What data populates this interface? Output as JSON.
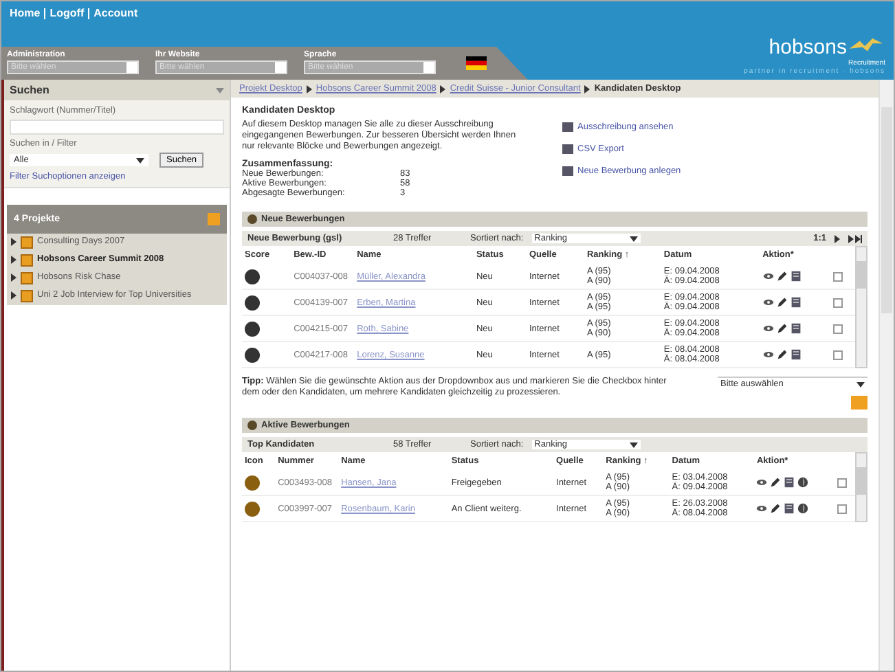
{
  "header": {
    "links": [
      "Home",
      "Logoff",
      "Account"
    ],
    "selectors": [
      {
        "label": "Administration",
        "placeholder": "Bitte wählen"
      },
      {
        "label": "Ihr Website",
        "placeholder": "Bitte wählen"
      },
      {
        "label": "Sprache",
        "placeholder": "Bitte wählen"
      }
    ],
    "logo": "hobsons",
    "logo_sub": "Recruitment",
    "tagline": "partner in recruitment · hobsons"
  },
  "sidebar": {
    "search": {
      "title": "Suchen",
      "keyword_label": "Schlagwort (Nummer/Titel)",
      "filter_label": "Suchen in / Filter",
      "filter_value": "Alle",
      "button": "Suchen",
      "link": "Filter Suchoptionen anzeigen"
    },
    "projects": {
      "title": "4 Projekte",
      "items": [
        {
          "label": "Consulting Days 2007",
          "selected": false
        },
        {
          "label": "Hobsons Career Summit 2008",
          "selected": true
        },
        {
          "label": "Hobsons Risk Chase",
          "selected": false
        },
        {
          "label": "Uni 2 Job Interview for Top Universities",
          "selected": false
        }
      ]
    }
  },
  "breadcrumb": {
    "links": [
      "Projekt Desktop",
      "Hobsons Career Summit 2008",
      "Credit Suisse - Junior Consultant"
    ],
    "current": "Kandidaten Desktop"
  },
  "intro": {
    "title": "Kandidaten Desktop",
    "text": "Auf diesem Desktop managen Sie alle zu dieser Ausschreibung eingegangenen Bewerbungen. Zur besseren Übersicht werden Ihnen nur relevante Blöcke und Bewerbungen angezeigt.",
    "summary_title": "Zusammenfassung:",
    "summary": [
      {
        "label": "Neue Bewerbungen:",
        "value": "83"
      },
      {
        "label": "Aktive Bewerbungen:",
        "value": "58"
      },
      {
        "label": "Abgesagte Bewerbungen:",
        "value": "3"
      }
    ],
    "actions": [
      "Ausschreibung ansehen",
      "CSV Export",
      "Neue Bewerbung anlegen"
    ]
  },
  "sections": [
    {
      "title": "Neue Bewerbungen",
      "list_title": "Neue Bewerbung (gsl)",
      "hits": "28 Treffer",
      "sort_label": "Sortiert nach:",
      "sort_value": "Ranking",
      "pager": "1:1",
      "columns": [
        "Score",
        "Bew.-ID",
        "Name",
        "Status",
        "Quelle",
        "Ranking ↑",
        "Datum",
        "Aktion*"
      ],
      "extra_action": false,
      "rows": [
        {
          "id": "C004037-008",
          "name": "Müller, Alexandra",
          "status": "Neu",
          "source": "Internet",
          "ranking": [
            "A (95)",
            "A (90)"
          ],
          "dates": [
            "E: 09.04.2008",
            "Ä: 09.04.2008"
          ],
          "checked": false
        },
        {
          "id": "C004139-007",
          "name": "Erben, Martina",
          "status": "Neu",
          "source": "Internet",
          "ranking": [
            "A (95)",
            "A (95)"
          ],
          "dates": [
            "E: 09.04.2008",
            "Ä: 09.04.2008"
          ],
          "checked": false
        },
        {
          "id": "C004215-007",
          "name": "Roth, Sabine",
          "status": "Neu",
          "source": "Internet",
          "ranking": [
            "A (95)",
            "A (90)"
          ],
          "dates": [
            "E: 09.04.2008",
            "Ä: 09.04.2008"
          ],
          "checked": false
        },
        {
          "id": "C004217-008",
          "name": "Lorenz, Susanne",
          "status": "Neu",
          "source": "Internet",
          "ranking": [
            "A (95)"
          ],
          "dates": [
            "E: 08.04.2008",
            "Ä: 08.04.2008"
          ],
          "checked": false
        }
      ],
      "tip": "**Tipp:** Wählen Sie die gewünschte Aktion aus der Dropdownbox aus und markieren Sie die Checkbox hinter dem oder den Kandidaten, um mehrere Kandidaten gleichzeitig zu prozessieren.",
      "tip_select": "Bitte auswählen"
    },
    {
      "title": "Aktive Bewerbungen",
      "list_title": "Top Kandidaten",
      "hits": "58 Treffer",
      "sort_label": "Sortiert nach:",
      "sort_value": "Ranking",
      "columns": [
        "Icon",
        "Nummer",
        "Name",
        "Status",
        "Quelle",
        "Ranking ↑",
        "Datum",
        "Aktion*"
      ],
      "extra_action": true,
      "rows": [
        {
          "id": "C003493-008",
          "name": "Hansen, Jana",
          "status": "Freigegeben",
          "source": "Internet",
          "ranking": [
            "A (95)",
            "A (90)"
          ],
          "dates": [
            "E: 03.04.2008",
            "Ä: 09.04.2008"
          ],
          "checked": false
        },
        {
          "id": "C003997-007",
          "name": "Rosenbaum, Karin",
          "status": "An Client weiterg.",
          "source": "Internet",
          "ranking": [
            "A (95)",
            "A (90)"
          ],
          "dates": [
            "E: 26.03.2008",
            "Ä: 08.04.2008"
          ],
          "checked": false
        }
      ]
    }
  ]
}
